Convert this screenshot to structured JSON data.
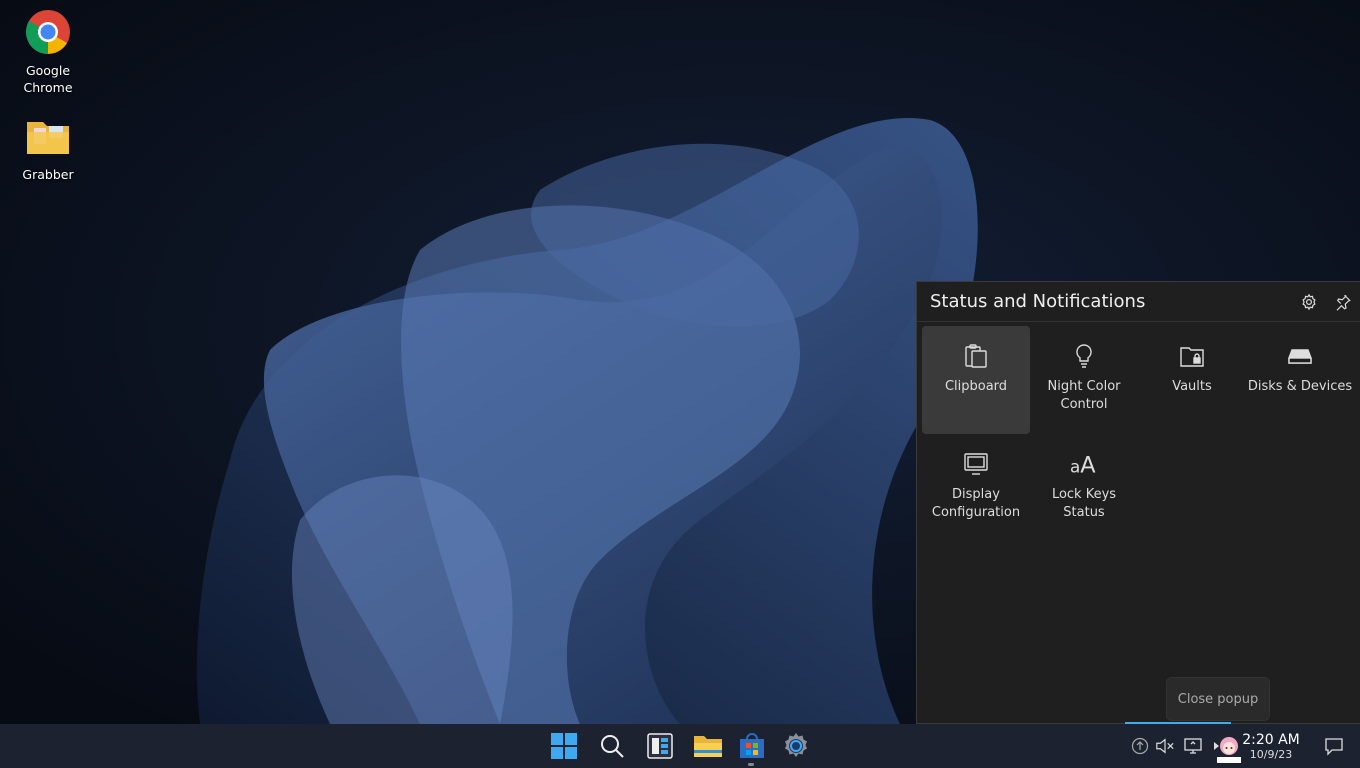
{
  "desktop": {
    "icons": [
      {
        "label_line1": "Google",
        "label_line2": "Chrome",
        "icon": "chrome-icon"
      },
      {
        "label_line1": "Grabber",
        "icon": "folder-icon"
      }
    ]
  },
  "popup": {
    "title": "Status and Notifications",
    "settings_icon": "gear-icon",
    "pin_icon": "pin-icon",
    "items": [
      {
        "l1": "Clipboard",
        "l2": "",
        "icon": "clipboard-icon"
      },
      {
        "l1": "Night Color",
        "l2": "Control",
        "icon": "lightbulb-icon"
      },
      {
        "l1": "Vaults",
        "l2": "",
        "icon": "vault-icon"
      },
      {
        "l1": "Disks & Devices",
        "l2": "",
        "icon": "drive-icon"
      },
      {
        "l1": "Display",
        "l2": "Configuration",
        "icon": "display-icon"
      },
      {
        "l1": "Lock Keys",
        "l2": "Status",
        "icon": "lock-keys-icon"
      }
    ]
  },
  "tooltip": {
    "text": "Close popup"
  },
  "taskbar": {
    "clock_time": "2:20 AM",
    "clock_date": "10/9/23",
    "accent": "#3daee9"
  }
}
